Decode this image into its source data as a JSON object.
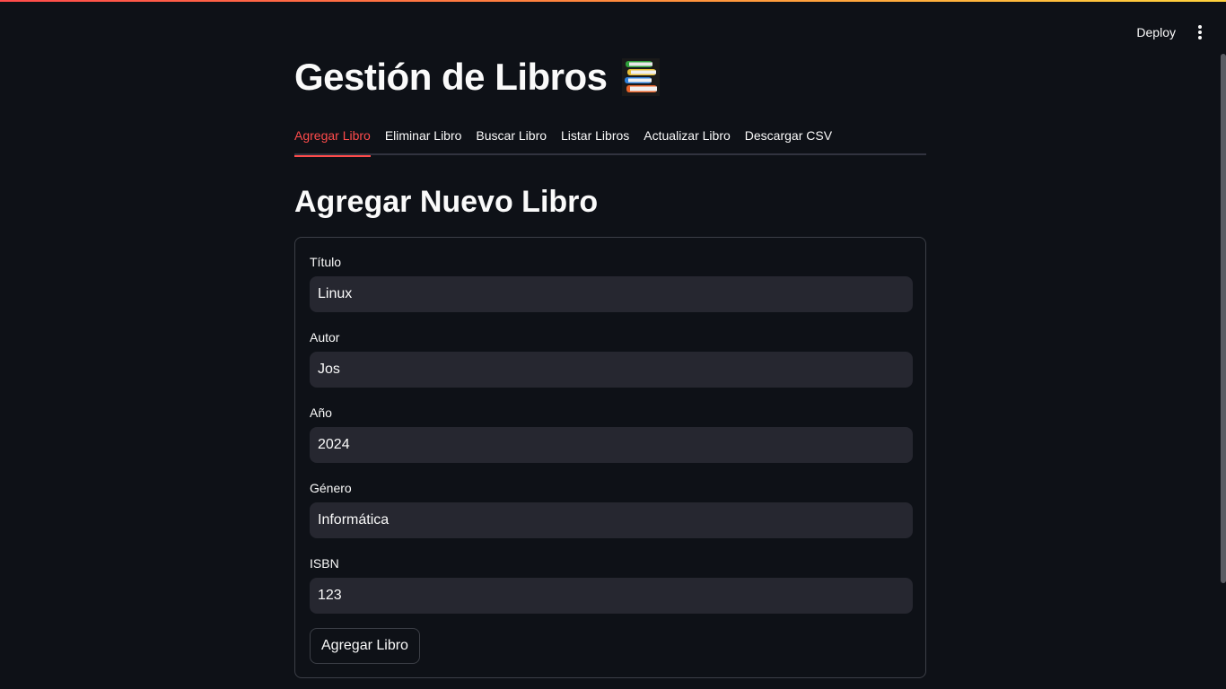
{
  "header": {
    "deploy_label": "Deploy",
    "menu_icon": "kebab-menu-icon"
  },
  "page": {
    "title": "Gestión de Libros",
    "title_icon": "books-emoji-icon"
  },
  "tabs": [
    {
      "label": "Agregar Libro",
      "active": true
    },
    {
      "label": "Eliminar Libro",
      "active": false
    },
    {
      "label": "Buscar Libro",
      "active": false
    },
    {
      "label": "Listar Libros",
      "active": false
    },
    {
      "label": "Actualizar Libro",
      "active": false
    },
    {
      "label": "Descargar CSV",
      "active": false
    }
  ],
  "section": {
    "title": "Agregar Nuevo Libro"
  },
  "form": {
    "fields": [
      {
        "label": "Título",
        "value": "Linux"
      },
      {
        "label": "Autor",
        "value": "Jos"
      },
      {
        "label": "Año",
        "value": "2024"
      },
      {
        "label": "Género",
        "value": "Informática"
      },
      {
        "label": "ISBN",
        "value": "123"
      }
    ],
    "submit_label": "Agregar Libro"
  },
  "colors": {
    "background": "#0e1117",
    "accent": "#ff4b4b",
    "input_bg": "#262730",
    "border": "#3c3f47"
  }
}
